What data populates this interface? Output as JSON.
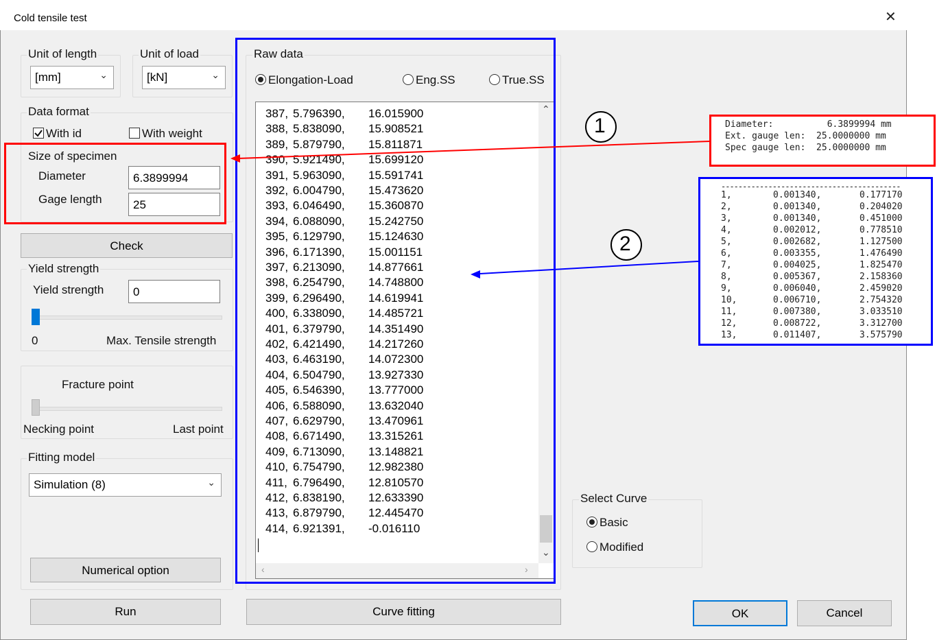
{
  "window": {
    "title": "Cold tensile test"
  },
  "unit_length": {
    "label": "Unit of length",
    "value": "[mm]"
  },
  "unit_load": {
    "label": "Unit of load",
    "value": "[kN]"
  },
  "data_format": {
    "label": "Data format",
    "with_id": "With id",
    "with_weight": "With weight"
  },
  "specimen": {
    "label": "Size of specimen",
    "diameter_label": "Diameter",
    "diameter_value": "6.3899994",
    "gage_label": "Gage length",
    "gage_value": "25"
  },
  "check_button": "Check",
  "yield": {
    "label": "Yield strength",
    "field_label": "Yield strength",
    "value": "0",
    "min_label": "0",
    "max_label": "Max. Tensile strength",
    "slider_level": 0
  },
  "fracture": {
    "label": "Fracture point",
    "left_label": "Necking point",
    "right_label": "Last point",
    "slider_level": 0
  },
  "fitting": {
    "label": "Fitting model",
    "value": "Simulation (8)"
  },
  "numerical_option_button": "Numerical option",
  "run_button": "Run",
  "raw_data": {
    "label": "Raw data",
    "modes": [
      "Elongation-Load",
      "Eng.SS",
      "True.SS"
    ],
    "selected_mode": "Elongation-Load",
    "rows": [
      [
        "387,",
        "5.796390,",
        "16.015900"
      ],
      [
        "388,",
        "5.838090,",
        "15.908521"
      ],
      [
        "389,",
        "5.879790,",
        "15.811871"
      ],
      [
        "390,",
        "5.921490,",
        "15.699120"
      ],
      [
        "391,",
        "5.963090,",
        "15.591741"
      ],
      [
        "392,",
        "6.004790,",
        "15.473620"
      ],
      [
        "393,",
        "6.046490,",
        "15.360870"
      ],
      [
        "394,",
        "6.088090,",
        "15.242750"
      ],
      [
        "395,",
        "6.129790,",
        "15.124630"
      ],
      [
        "396,",
        "6.171390,",
        "15.001151"
      ],
      [
        "397,",
        "6.213090,",
        "14.877661"
      ],
      [
        "398,",
        "6.254790,",
        "14.748800"
      ],
      [
        "399,",
        "6.296490,",
        "14.619941"
      ],
      [
        "400,",
        "6.338090,",
        "14.485721"
      ],
      [
        "401,",
        "6.379790,",
        "14.351490"
      ],
      [
        "402,",
        "6.421490,",
        "14.217260"
      ],
      [
        "403,",
        "6.463190,",
        "14.072300"
      ],
      [
        "404,",
        "6.504790,",
        "13.927330"
      ],
      [
        "405,",
        "6.546390,",
        "13.777000"
      ],
      [
        "406,",
        "6.588090,",
        "13.632040"
      ],
      [
        "407,",
        "6.629790,",
        "13.470961"
      ],
      [
        "408,",
        "6.671490,",
        "13.315261"
      ],
      [
        "409,",
        "6.713090,",
        "13.148821"
      ],
      [
        "410,",
        "6.754790,",
        "12.982380"
      ],
      [
        "411,",
        "6.796490,",
        "12.810570"
      ],
      [
        "412,",
        "6.838190,",
        "12.633390"
      ],
      [
        "413,",
        "6.879790,",
        "12.445470"
      ],
      [
        "414,",
        "6.921391,",
        "-0.016110"
      ]
    ]
  },
  "curve_fitting_button": "Curve fitting",
  "select_curve": {
    "label": "Select Curve",
    "options": [
      "Basic",
      "Modified"
    ],
    "selected": "Basic"
  },
  "ok_button": "OK",
  "cancel_button": "Cancel",
  "callouts": {
    "one": "1",
    "two": "2"
  },
  "file_header": {
    "lines": [
      "Diameter:          6.3899994 mm",
      "Ext. gauge len:  25.0000000 mm",
      "Spec gauge len:  25.0000000 mm"
    ]
  },
  "file_data": {
    "separator": "------------------------------------------",
    "rows": [
      [
        "1,",
        "0.001340,",
        "0.177170"
      ],
      [
        "2,",
        "0.001340,",
        "0.204020"
      ],
      [
        "3,",
        "0.001340,",
        "0.451000"
      ],
      [
        "4,",
        "0.002012,",
        "0.778510"
      ],
      [
        "5,",
        "0.002682,",
        "1.127500"
      ],
      [
        "6,",
        "0.003355,",
        "1.476490"
      ],
      [
        "7,",
        "0.004025,",
        "1.825470"
      ],
      [
        "8,",
        "0.005367,",
        "2.158360"
      ],
      [
        "9,",
        "0.006040,",
        "2.459020"
      ],
      [
        "10,",
        "0.006710,",
        "2.754320"
      ],
      [
        "11,",
        "0.007380,",
        "3.033510"
      ],
      [
        "12,",
        "0.008722,",
        "3.312700"
      ],
      [
        "13,",
        "0.011407,",
        "3.575790"
      ]
    ]
  },
  "colors": {
    "highlight_red": "#ff0000",
    "highlight_blue": "#0000ff",
    "default_button_border": "#0078d7"
  }
}
